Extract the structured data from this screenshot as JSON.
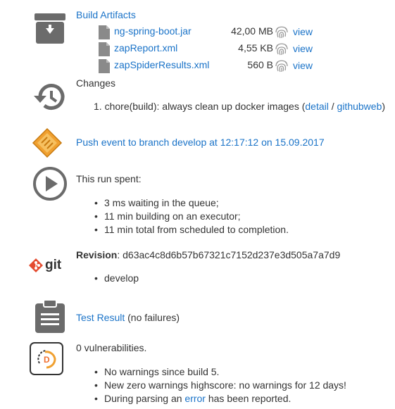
{
  "artifacts": {
    "title": "Build Artifacts",
    "files": [
      {
        "name": "ng-spring-boot.jar",
        "size": "42,00 MB",
        "view": "view"
      },
      {
        "name": "zapReport.xml",
        "size": "4,55 KB",
        "view": "view"
      },
      {
        "name": "zapSpiderResults.xml",
        "size": "560 B",
        "view": "view"
      }
    ]
  },
  "changes": {
    "title": "Changes",
    "items": [
      {
        "number": "1.",
        "text": "chore(build): always clean up docker images (",
        "detail": "detail",
        "sep": " / ",
        "githubweb": "githubweb",
        "close": ")"
      }
    ]
  },
  "push": {
    "text": "Push event to branch develop at 12:17:12 on 15.09.2017"
  },
  "timing": {
    "title": "This run spent:",
    "items": [
      "3 ms waiting in the queue;",
      "11 min building on an executor;",
      "11 min total from scheduled to completion."
    ]
  },
  "git": {
    "logo_text": "git",
    "label": "Revision",
    "hash": ": d63ac4c8d6b57b67321c7152d237e3d505a7a7d9",
    "branches": [
      "develop"
    ]
  },
  "tests": {
    "link": "Test Result",
    "suffix": " (no failures)"
  },
  "warnings": {
    "title": "0 vulnerabilities.",
    "items": [
      {
        "text": "No warnings since build 5."
      },
      {
        "text": "New zero warnings highscore: no warnings for 12 days!"
      },
      {
        "prefix": "During parsing an ",
        "link": "error",
        "suffix": " has been reported."
      }
    ]
  },
  "colors": {
    "link": "#1a73c8",
    "icon_gray": "#6b6b6b",
    "push_orange": "#f0a030"
  }
}
